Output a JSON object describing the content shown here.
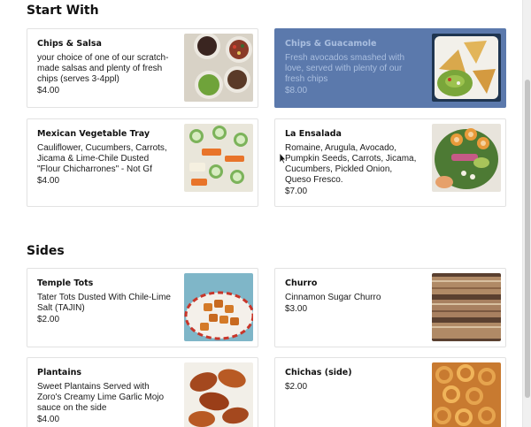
{
  "sections": [
    {
      "title": "Start With",
      "items": [
        {
          "name": "Chips & Salsa",
          "desc": "your choice of one of our scratch-made salsas and plenty of fresh chips (serves 3-4ppl)",
          "price": "$4.00",
          "photo": "salsa-bowls-photo"
        },
        {
          "name": "Chips & Guacamole",
          "desc": "Fresh avocados smashed with love, served with plenty of our fresh chips",
          "price": "$8.00",
          "photo": "guacamole-chips-photo"
        },
        {
          "name": "Mexican Vegetable Tray",
          "desc": "Cauliflower, Cucumbers, Carrots, Jicama & Lime-Chile Dusted \"Flour Chicharrones\" - Not Gf",
          "price": "$4.00",
          "photo": "vegetable-tray-photo"
        },
        {
          "name": "La Ensalada",
          "desc": "Romaine, Arugula, Avocado, Pumpkin Seeds, Carrots, Jicama, Cucumbers, Pickled Onion, Queso Fresco.",
          "price": "$7.00",
          "photo": "salad-photo"
        }
      ]
    },
    {
      "title": "Sides",
      "items": [
        {
          "name": "Temple Tots",
          "desc": "Tater Tots Dusted With Chile-Lime Salt (TAJIN)",
          "price": "$2.00",
          "photo": "tater-tots-photo"
        },
        {
          "name": "Churro",
          "desc": "Cinnamon Sugar Churro",
          "price": "$3.00",
          "photo": "churro-photo"
        },
        {
          "name": "Plantains",
          "desc": "Sweet Plantains Served with Zoro's Creamy Lime Garlic Mojo sauce on the side",
          "price": "$4.00",
          "photo": "plantains-photo"
        },
        {
          "name": "Chichas (side)",
          "desc": "",
          "price": "$2.00",
          "photo": "chichas-photo"
        }
      ]
    }
  ],
  "colors": {
    "highlight_card": "#5b79ac",
    "highlight_text": "#a9bedf"
  }
}
